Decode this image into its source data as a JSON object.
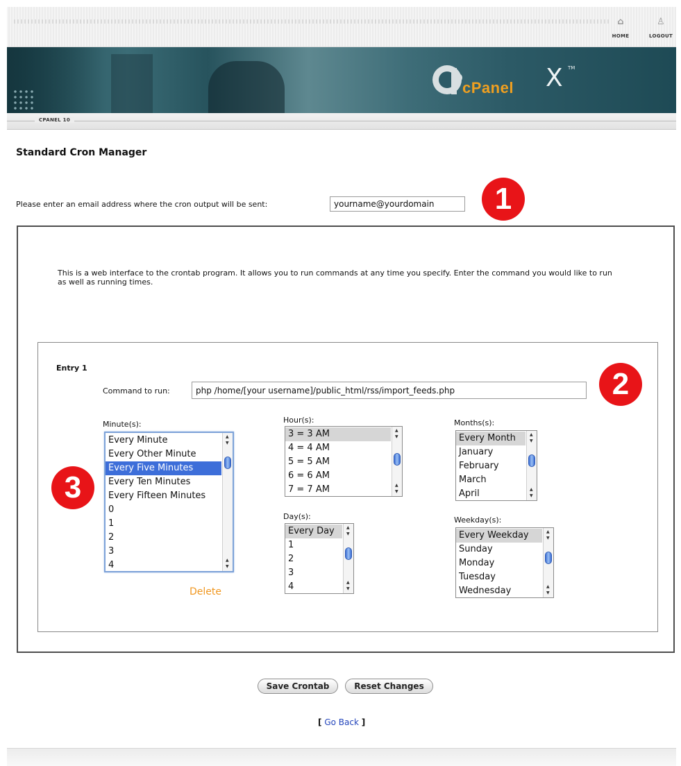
{
  "topbar": {
    "home_label": "HOME",
    "logout_label": "LOGOUT"
  },
  "banner": {
    "brand": "cPanel",
    "version_mark": "X",
    "trademark": "TM"
  },
  "breadcrumb": {
    "label": "CPANEL 10"
  },
  "page": {
    "title": "Standard Cron Manager",
    "email_label": "Please enter an email address where the cron output will be sent:",
    "email_value": "yourname@yourdomain",
    "intro": "This is a web interface to the crontab program. It allows you to run commands at any time you specify. Enter the command you would like to run as well as running times."
  },
  "badges": {
    "one": "1",
    "two": "2",
    "three": "3"
  },
  "entry": {
    "title": "Entry 1",
    "command_label": "Command to run:",
    "command_value": "php /home/[your username]/public_html/rss/import_feeds.php",
    "minutes": {
      "label": "Minute(s):",
      "options": [
        "Every Minute",
        "Every Other Minute",
        "Every Five Minutes",
        "Every Ten Minutes",
        "Every Fifteen Minutes",
        "0",
        "1",
        "2",
        "3",
        "4"
      ],
      "selected": "Every Five Minutes"
    },
    "hours": {
      "label": "Hour(s):",
      "options": [
        "3 = 3 AM",
        "4 = 4 AM",
        "5 = 5 AM",
        "6 = 6 AM",
        "7 = 7 AM"
      ],
      "selected": "3 = 3 AM"
    },
    "days": {
      "label": "Day(s):",
      "options": [
        "Every Day",
        "1",
        "2",
        "3",
        "4"
      ],
      "selected": "Every Day"
    },
    "months": {
      "label": "Months(s):",
      "options": [
        "Every Month",
        "January",
        "February",
        "March",
        "April"
      ],
      "selected": "Every Month"
    },
    "weekdays": {
      "label": "Weekday(s):",
      "options": [
        "Every Weekday",
        "Sunday",
        "Monday",
        "Tuesday",
        "Wednesday"
      ],
      "selected": "Every Weekday"
    },
    "delete_label": "Delete"
  },
  "actions": {
    "save_label": "Save Crontab",
    "reset_label": "Reset Changes",
    "go_back_open": "[",
    "go_back_label": "Go Back",
    "go_back_close": "]"
  },
  "icons": {
    "home": "home-icon",
    "logout": "logout-icon"
  },
  "colors": {
    "badge_red": "#e81418",
    "delete_orange": "#f0961e",
    "cpanel_orange": "#f0a020",
    "selection_blue": "#3d6ed9",
    "banner_teal": "#2c5a66"
  }
}
